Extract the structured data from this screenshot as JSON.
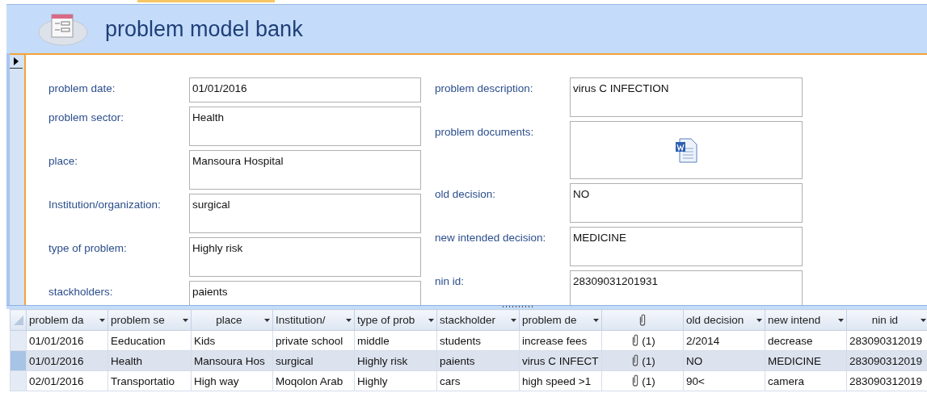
{
  "form": {
    "title": "problem model bank",
    "fields_left": [
      {
        "label": "problem date:",
        "value": "01/01/2016"
      },
      {
        "label": "problem sector:",
        "value": "Health"
      },
      {
        "label": "place:",
        "value": "Mansoura Hospital"
      },
      {
        "label": "Institution/organization:",
        "value": "surgical"
      },
      {
        "label": "type of problem:",
        "value": "Highly risk"
      },
      {
        "label": "stackholders:",
        "value": "paients"
      }
    ],
    "fields_right": [
      {
        "label": "problem description:",
        "value": "virus C INFECTION",
        "kind": "text"
      },
      {
        "label": "problem documents:",
        "kind": "attachment"
      },
      {
        "label": "old decision:",
        "value": "NO",
        "kind": "text"
      },
      {
        "label": "new intended decision:",
        "value": "MEDICINE",
        "kind": "text"
      },
      {
        "label": "nin id:",
        "value": "28309031201931",
        "kind": "text"
      }
    ]
  },
  "datasheet": {
    "columns": [
      {
        "kind": "text",
        "label": "problem da"
      },
      {
        "kind": "text",
        "label": "problem se"
      },
      {
        "kind": "text",
        "label": "place"
      },
      {
        "kind": "text",
        "label": "Institution/"
      },
      {
        "kind": "text",
        "label": "type of prob"
      },
      {
        "kind": "text",
        "label": "stackholder"
      },
      {
        "kind": "text",
        "label": "problem de"
      },
      {
        "kind": "attachment"
      },
      {
        "kind": "text",
        "label": "old decision"
      },
      {
        "kind": "text",
        "label": "new intend"
      },
      {
        "kind": "text",
        "label": "nin id"
      }
    ],
    "rows": [
      {
        "selected": false,
        "cells": [
          "01/01/2016",
          "Eeducation",
          "Kids",
          "private school",
          "middle",
          "students",
          "increase fees",
          "(1)",
          "2/2014",
          "decrease",
          "283090312019"
        ]
      },
      {
        "selected": true,
        "cells": [
          "01/01/2016",
          "Health",
          "Mansoura Hos",
          "surgical",
          "Highly risk",
          "paients",
          "virus C INFECT",
          "(1)",
          "NO",
          "MEDICINE",
          "283090312019"
        ]
      },
      {
        "selected": false,
        "cells": [
          "02/01/2016",
          "Transportatio",
          "High way",
          "Moqolon Arab",
          "Highly",
          "cars",
          "high speed >1",
          "(1)",
          "90<",
          "camera",
          "283090312019"
        ]
      }
    ]
  }
}
